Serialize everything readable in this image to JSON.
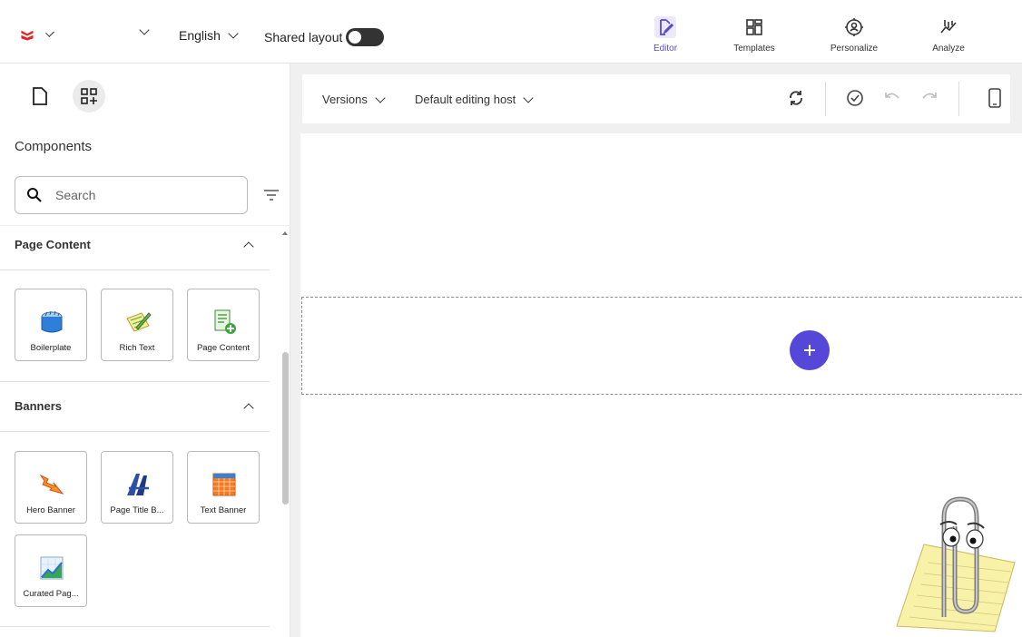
{
  "topbar": {
    "logo_name": "sitecore-logo",
    "language": "English",
    "shared_layout_label": "Shared layout",
    "shared_layout_on": false,
    "nav": [
      {
        "label": "Editor",
        "icon": "editor-icon",
        "active": true
      },
      {
        "label": "Templates",
        "icon": "templates-icon",
        "active": false
      },
      {
        "label": "Personalize",
        "icon": "personalize-icon",
        "active": false
      },
      {
        "label": "Analyze",
        "icon": "analyze-icon",
        "active": false
      }
    ],
    "accent_color": "#5548d9"
  },
  "leftpanel": {
    "title": "Components",
    "search_placeholder": "Search",
    "sections": [
      {
        "label": "Page Content",
        "expanded": true,
        "items": [
          {
            "label": "Boilerplate",
            "icon": "boilerplate-icon"
          },
          {
            "label": "Rich Text",
            "icon": "rich-text-icon"
          },
          {
            "label": "Page Content",
            "icon": "page-content-icon"
          }
        ]
      },
      {
        "label": "Banners",
        "expanded": true,
        "items": [
          {
            "label": "Hero Banner",
            "icon": "hero-banner-icon"
          },
          {
            "label": "Page Title B...",
            "icon": "page-title-banner-icon"
          },
          {
            "label": "Text Banner",
            "icon": "text-banner-icon"
          },
          {
            "label": "Curated Pag...",
            "icon": "curated-page-icon"
          }
        ]
      }
    ]
  },
  "toolbar": {
    "versions_label": "Versions",
    "editing_host_label": "Default editing host"
  },
  "canvas": {
    "add_component_label": "+"
  }
}
